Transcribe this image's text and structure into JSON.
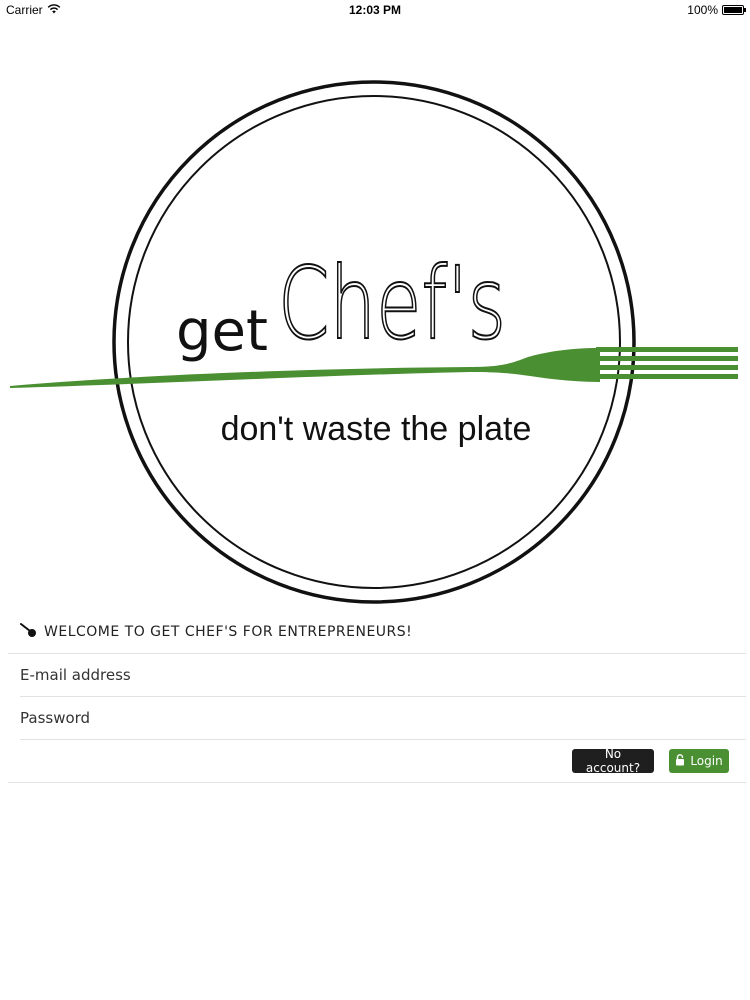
{
  "status_bar": {
    "carrier": "Carrier",
    "time": "12:03 PM",
    "battery": "100%"
  },
  "logo": {
    "brand_prefix": "get",
    "brand_name": "Chef's",
    "tagline": "don't waste the plate",
    "fork_color": "#4a8f32"
  },
  "welcome": {
    "text": "WELCOME TO GET CHEF'S FOR ENTREPRENEURS!"
  },
  "form": {
    "email_placeholder": "E-mail address",
    "password_placeholder": "Password"
  },
  "actions": {
    "no_account_label": "No account?",
    "login_label": "Login"
  },
  "colors": {
    "accent_green": "#4a8f32",
    "dark_button": "#1f1f1f"
  }
}
